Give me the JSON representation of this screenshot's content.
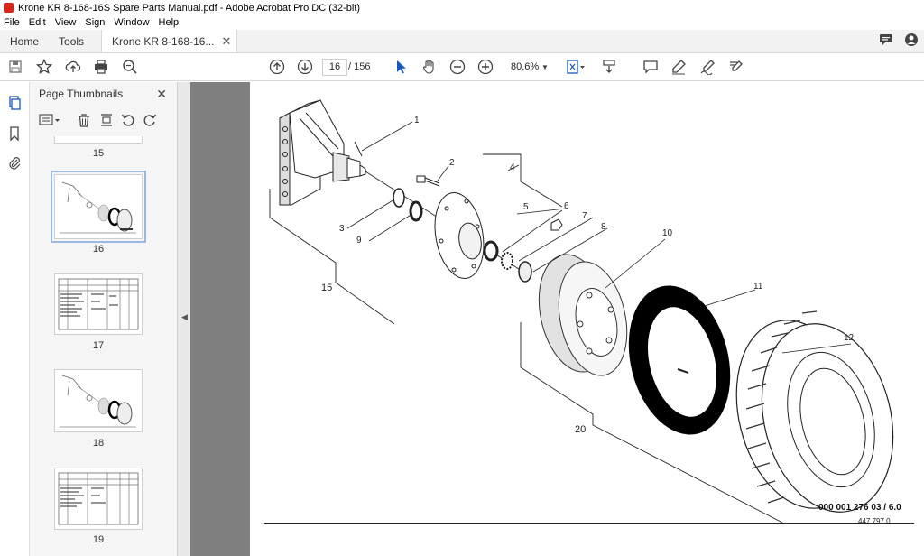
{
  "window": {
    "title": "Krone KR 8-168-16S Spare Parts Manual.pdf - Adobe Acrobat Pro DC (32-bit)"
  },
  "menu": [
    "File",
    "Edit",
    "View",
    "Sign",
    "Window",
    "Help"
  ],
  "tabs": {
    "home": "Home",
    "tools": "Tools",
    "document": "Krone KR 8-168-16...",
    "close": "✕"
  },
  "toolbar": {
    "current_page": "16",
    "page_separator": "/ 156",
    "zoom": "80,6%"
  },
  "thumbnails": {
    "title": "Page Thumbnails",
    "close": "✕",
    "pages": [
      {
        "label": "15"
      },
      {
        "label": "16"
      },
      {
        "label": "17"
      },
      {
        "label": "18"
      },
      {
        "label": "19"
      }
    ]
  },
  "diagram": {
    "callouts": [
      "1",
      "2",
      "3",
      "4",
      "5",
      "6",
      "7",
      "8",
      "9",
      "10",
      "11",
      "12",
      "15",
      "20"
    ],
    "doc_number": "000 001 276 03 / 6.0",
    "doc_sub": "447 797 0"
  },
  "colors": {
    "accent": "#1a73e8",
    "doc_background": "#7f7f7f",
    "panel_background": "#f5f5f5"
  }
}
